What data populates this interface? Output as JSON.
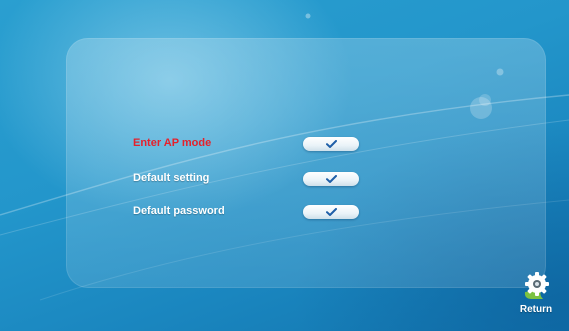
{
  "menu": {
    "items": [
      {
        "label": "Enter AP mode",
        "checked": true,
        "highlighted": true
      },
      {
        "label": "Default setting",
        "checked": true,
        "highlighted": false
      },
      {
        "label": "Default password",
        "checked": true,
        "highlighted": false
      }
    ]
  },
  "return_button": {
    "label": "Return",
    "icon": "gear-icon"
  },
  "icons": {
    "toggle_mark": "checkmark-icon"
  },
  "colors": {
    "highlight_text": "#e4212c",
    "normal_text": "#ffffff",
    "checkmark": "#1f5fa8",
    "gear_body": "#ffffff",
    "gear_accent": "#7cc242"
  }
}
